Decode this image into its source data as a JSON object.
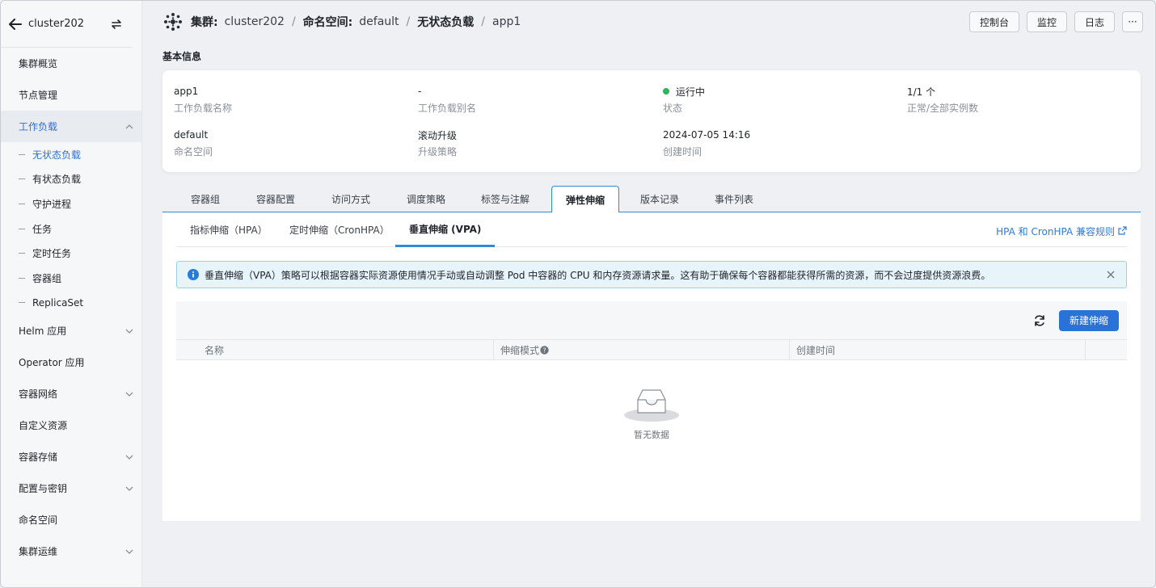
{
  "sidebar": {
    "cluster_name": "cluster202",
    "items": [
      {
        "label": "集群概览",
        "expandable": false
      },
      {
        "label": "节点管理",
        "expandable": false
      },
      {
        "label": "工作负载",
        "expandable": true,
        "open": true
      },
      {
        "label": "Helm 应用",
        "expandable": true
      },
      {
        "label": "Operator 应用",
        "expandable": false
      },
      {
        "label": "容器网络",
        "expandable": true
      },
      {
        "label": "自定义资源",
        "expandable": false
      },
      {
        "label": "容器存储",
        "expandable": true
      },
      {
        "label": "配置与密钥",
        "expandable": true
      },
      {
        "label": "命名空间",
        "expandable": false
      },
      {
        "label": "集群运维",
        "expandable": true
      }
    ],
    "workload_sub": [
      "无状态负载",
      "有状态负载",
      "守护进程",
      "任务",
      "定时任务",
      "容器组",
      "ReplicaSet"
    ],
    "active_sub": "无状态负载"
  },
  "breadcrumb": {
    "cluster_key": "集群:",
    "cluster_val": "cluster202",
    "ns_key": "命名空间:",
    "ns_val": "default",
    "kind": "无状态负载",
    "name": "app1",
    "sep": "/"
  },
  "header_buttons": {
    "console": "控制台",
    "monitor": "监控",
    "logs": "日志",
    "more": "···"
  },
  "basic_info": {
    "title": "基本信息",
    "fields": [
      {
        "value": "app1",
        "key": "工作负载名称"
      },
      {
        "value": "-",
        "key": "工作负载别名"
      },
      {
        "value": "运行中",
        "key": "状态"
      },
      {
        "value": "1/1 个",
        "key": "正常/全部实例数"
      },
      {
        "value": "default",
        "key": "命名空间"
      },
      {
        "value": "滚动升级",
        "key": "升级策略"
      },
      {
        "value": "2024-07-05 14:16",
        "key": "创建时间"
      }
    ]
  },
  "tabs": [
    "容器组",
    "容器配置",
    "访问方式",
    "调度策略",
    "标签与注解",
    "弹性伸缩",
    "版本记录",
    "事件列表"
  ],
  "active_tab": "弹性伸缩",
  "subtabs": [
    "指标伸缩（HPA）",
    "定时伸缩（CronHPA）",
    "垂直伸缩 (VPA)"
  ],
  "active_subtab": "垂直伸缩 (VPA)",
  "rule_link": "HPA 和 CronHPA 兼容规则",
  "alert": "垂直伸缩（VPA）策略可以根据容器实际资源使用情况手动或自动调整 Pod 中容器的 CPU 和内存资源请求量。这有助于确保每个容器都能获得所需的资源，而不会过度提供资源浪费。",
  "table": {
    "create_button": "新建伸缩",
    "columns": [
      "名称",
      "伸缩模式",
      "创建时间",
      ""
    ],
    "empty_text": "暂无数据"
  },
  "colors": {
    "accent": "#2872d8",
    "status_running": "#2bb55c",
    "alert_bg": "#e7f4fa"
  }
}
